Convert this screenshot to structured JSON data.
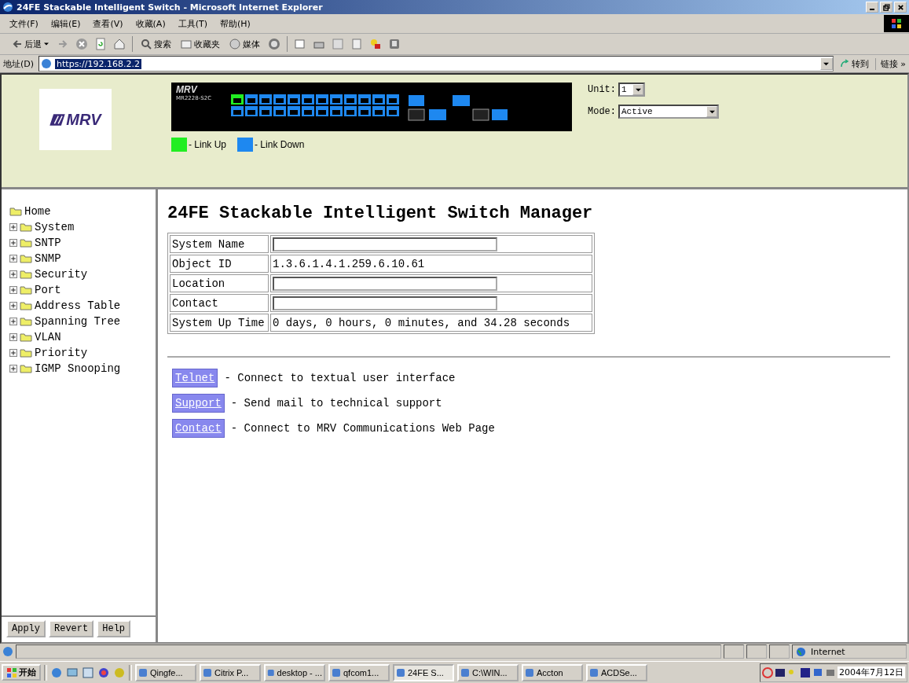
{
  "window": {
    "title": "24FE Stackable Intelligent Switch - Microsoft Internet Explorer"
  },
  "menu": [
    "文件(F)",
    "编辑(E)",
    "查看(V)",
    "收藏(A)",
    "工具(T)",
    "帮助(H)"
  ],
  "toolbar": {
    "back": "后退",
    "search": "搜索",
    "favorites": "收藏夹",
    "media": "媒体"
  },
  "address": {
    "label": "地址(D)",
    "value": "https://192.168.2.2",
    "go": "转到",
    "links": "链接 »"
  },
  "header": {
    "logo": "MRV",
    "device_brand": "MRV",
    "device_model": "MR2228-S2C",
    "ports": [
      {
        "up": true
      },
      {
        "up": false
      },
      {
        "up": false
      },
      {
        "up": false
      },
      {
        "up": false
      },
      {
        "up": false
      },
      {
        "up": false
      },
      {
        "up": false
      },
      {
        "up": false
      },
      {
        "up": false
      },
      {
        "up": false
      },
      {
        "up": false
      },
      {
        "up": false
      },
      {
        "up": false
      },
      {
        "up": false
      },
      {
        "up": false
      },
      {
        "up": false
      },
      {
        "up": false
      },
      {
        "up": false
      },
      {
        "up": false
      },
      {
        "up": false
      },
      {
        "up": false
      },
      {
        "up": false
      },
      {
        "up": false
      }
    ],
    "legend": [
      {
        "label": "- Link Up",
        "color": "#22ee22"
      },
      {
        "label": "- Link Down",
        "color": "#1e88f0"
      }
    ],
    "unit": {
      "label": "Unit:",
      "value": "1"
    },
    "mode": {
      "label": "Mode:",
      "value": "Active"
    }
  },
  "sidebar": {
    "root": "Home",
    "children": [
      {
        "label": "System",
        "expanded": false
      },
      {
        "label": "SNTP",
        "expanded": false
      },
      {
        "label": "SNMP",
        "expanded": false
      },
      {
        "label": "Security",
        "expanded": false
      },
      {
        "label": "Port",
        "expanded": false
      },
      {
        "label": "Address Table",
        "expanded": false
      },
      {
        "label": "Spanning Tree",
        "expanded": false
      },
      {
        "label": "VLAN",
        "expanded": false
      },
      {
        "label": "Priority",
        "expanded": false
      },
      {
        "label": "IGMP Snooping",
        "expanded": false
      }
    ],
    "buttons": [
      "Apply",
      "Revert",
      "Help"
    ]
  },
  "main": {
    "title": "24FE Stackable Intelligent Switch Manager",
    "rows": [
      {
        "label": "System Name",
        "kind": "field"
      },
      {
        "label": "Object ID",
        "kind": "text",
        "value": "1.3.6.1.4.1.259.6.10.61"
      },
      {
        "label": "Location",
        "kind": "field"
      },
      {
        "label": "Contact",
        "kind": "field"
      },
      {
        "label": "System Up Time",
        "kind": "text",
        "value": "0 days, 0 hours, 0 minutes, and 34.28 seconds"
      }
    ],
    "links": [
      {
        "label": "Telnet",
        "text": "- Connect to textual user interface"
      },
      {
        "label": "Support",
        "text": "- Send mail to technical support"
      },
      {
        "label": "Contact",
        "text": "- Connect to MRV Communications Web Page"
      }
    ]
  },
  "status_bar": {
    "zone": "Internet"
  },
  "taskbar": {
    "start": "开始",
    "tasks": [
      {
        "label": "Qingfe...",
        "selected": false
      },
      {
        "label": "Citrix P...",
        "selected": false
      },
      {
        "label": "desktop - ...",
        "selected": false
      },
      {
        "label": "qfcom1...",
        "selected": false
      },
      {
        "label": "24FE S...",
        "selected": true
      },
      {
        "label": "C:\\WIN...",
        "selected": false
      },
      {
        "label": "Accton",
        "selected": false
      },
      {
        "label": "ACDSe...",
        "selected": false
      }
    ],
    "clock": "2004年7月12日"
  }
}
